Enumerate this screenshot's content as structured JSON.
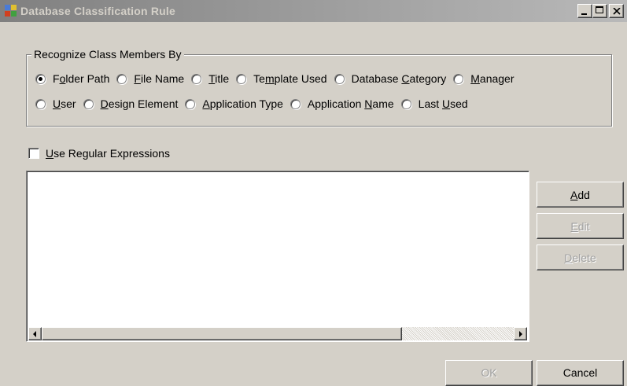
{
  "window": {
    "title": "Database Classification Rule",
    "icon": "window-app-icon",
    "controls": [
      "minimize",
      "maximize",
      "close"
    ]
  },
  "group": {
    "legend": "Recognize Class Members By",
    "options": [
      {
        "pre": "F",
        "ul": "o",
        "post": "lder Path",
        "selected": true
      },
      {
        "pre": "",
        "ul": "F",
        "post": "ile Name",
        "selected": false
      },
      {
        "pre": "",
        "ul": "T",
        "post": "itle",
        "selected": false
      },
      {
        "pre": "Te",
        "ul": "m",
        "post": "plate Used",
        "selected": false
      },
      {
        "pre": "Database ",
        "ul": "C",
        "post": "ategory",
        "selected": false
      },
      {
        "pre": "",
        "ul": "M",
        "post": "anager",
        "selected": false
      },
      {
        "pre": "",
        "ul": "U",
        "post": "ser",
        "selected": false
      },
      {
        "pre": "",
        "ul": "D",
        "post": "esign Element",
        "selected": false
      },
      {
        "pre": "",
        "ul": "A",
        "post": "pplication Type",
        "selected": false
      },
      {
        "pre": "Application ",
        "ul": "N",
        "post": "ame",
        "selected": false
      },
      {
        "pre": "Last ",
        "ul": "U",
        "post": "sed",
        "selected": false
      }
    ]
  },
  "regex": {
    "pre": "",
    "ul": "U",
    "post": "se Regular Expressions",
    "checked": false
  },
  "buttons": {
    "add": {
      "ul": "A",
      "post": "dd"
    },
    "edit": {
      "ul": "E",
      "post": "dit"
    },
    "delete": {
      "ul": "D",
      "post": "elete"
    },
    "ok": {
      "label": "OK"
    },
    "cancel": {
      "label": "Cancel"
    }
  }
}
